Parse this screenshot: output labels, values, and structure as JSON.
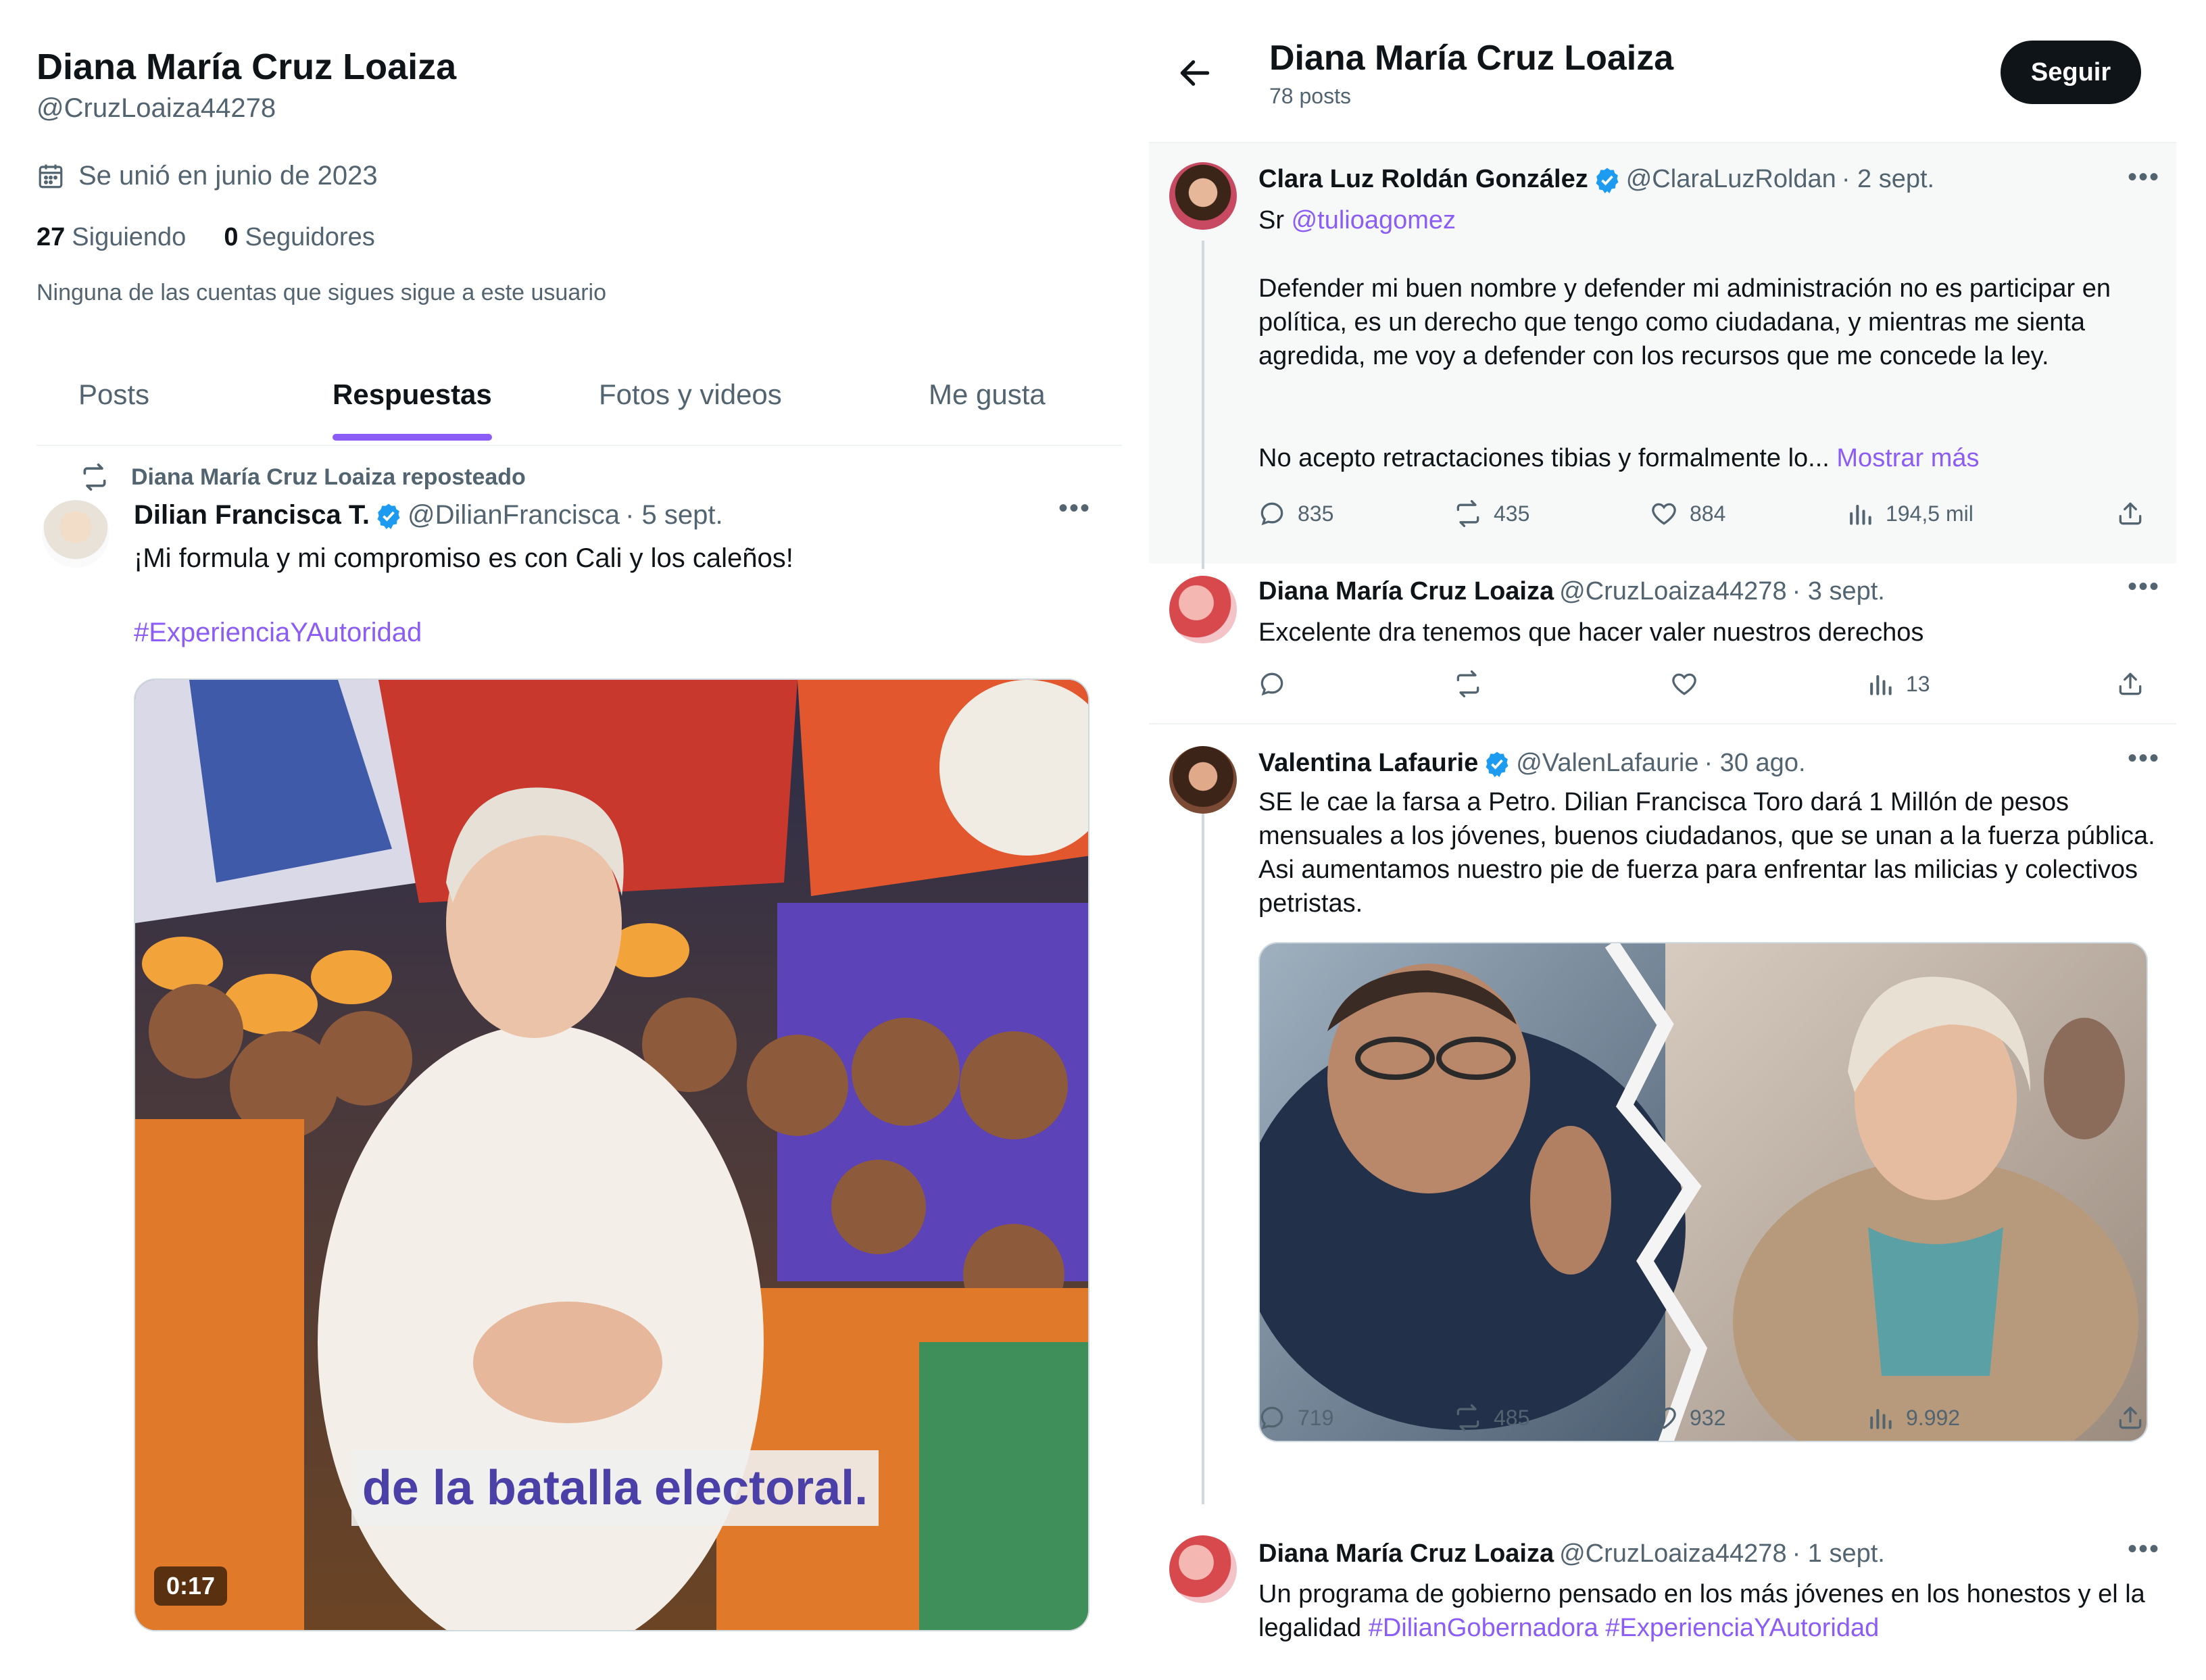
{
  "profile": {
    "name": "Diana María Cruz Loaiza",
    "handle": "@CruzLoaiza44278",
    "joined": "Se unió en junio de 2023",
    "following_count": "27",
    "following_label": "Siguiendo",
    "followers_count": "0",
    "followers_label": "Seguidores",
    "mutual_note": "Ninguna de las cuentas que sigues sigue a este usuario"
  },
  "tabs": [
    {
      "label": "Posts",
      "active": false
    },
    {
      "label": "Respuestas",
      "active": true
    },
    {
      "label": "Fotos y videos",
      "active": false
    },
    {
      "label": "Me gusta",
      "active": false
    }
  ],
  "repost_tweet": {
    "repost_label": "Diana María Cruz Loaiza reposteado",
    "author": "Dilian Francisca T.",
    "handle": "@DilianFrancisca",
    "date": "· 5 sept.",
    "text": "¡Mi formula y mi compromiso es con Cali y los caleños!",
    "hashtag": "#ExperienciaYAutoridad",
    "video_caption": "de la batalla electoral.",
    "video_time": "0:17"
  },
  "thread_header": {
    "title": "Diana María Cruz Loaiza",
    "posts": "78 posts",
    "follow_label": "Seguir"
  },
  "thread": [
    {
      "author": "Clara Luz Roldán González",
      "verified": true,
      "handle": "@ClaraLuzRoldan",
      "date": "· 2 sept.",
      "prefix": "Sr",
      "mention": "@tulioagomez",
      "para1": "Defender mi buen nombre y defender mi administración no es participar en política, es un derecho que tengo como ciudadana, y mientras me sienta agredida, me voy a defender con los recursos que me concede la ley.",
      "para2": "No acepto retractaciones tibias y formalmente lo...",
      "show_more": "Mostrar más",
      "replies": "835",
      "reposts": "435",
      "likes": "884",
      "views": "194,5 mil"
    },
    {
      "author": "Diana María Cruz Loaiza",
      "verified": false,
      "handle": "@CruzLoaiza44278",
      "date": "· 3 sept.",
      "text": "Excelente dra tenemos que hacer valer nuestros derechos",
      "replies": "",
      "reposts": "",
      "likes": "",
      "views": "13"
    },
    {
      "author": "Valentina Lafaurie",
      "verified": true,
      "handle": "@ValenLafaurie",
      "date": "· 30 ago.",
      "text": "SE le cae la farsa a Petro. Dilian Francisca Toro dará 1 Millón de pesos mensuales a los jóvenes, buenos ciudadanos, que se unan a la fuerza pública. Asi aumentamos nuestro pie de fuerza para enfrentar las milicias y colectivos petristas.",
      "replies": "719",
      "reposts": "485",
      "likes": "932",
      "views": "9.992"
    },
    {
      "author": "Diana María Cruz Loaiza",
      "verified": false,
      "handle": "@CruzLoaiza44278",
      "date": "· 1 sept.",
      "text": "Un programa de gobierno pensado en los más jóvenes en los honestos y el la legalidad",
      "hashtag1": "#DilianGobernadora",
      "hashtag2": "#ExperienciaYAutoridad"
    }
  ],
  "colors": {
    "accent": "#8b5cf6",
    "verified": "#1d9bf0",
    "text": "#0f1419",
    "muted": "#536471"
  },
  "icons": [
    "calendar-icon",
    "repost-icon",
    "verified-badge-icon",
    "more-icon",
    "back-arrow-icon",
    "reply-icon",
    "retweet-icon",
    "like-icon",
    "views-icon",
    "share-icon"
  ]
}
